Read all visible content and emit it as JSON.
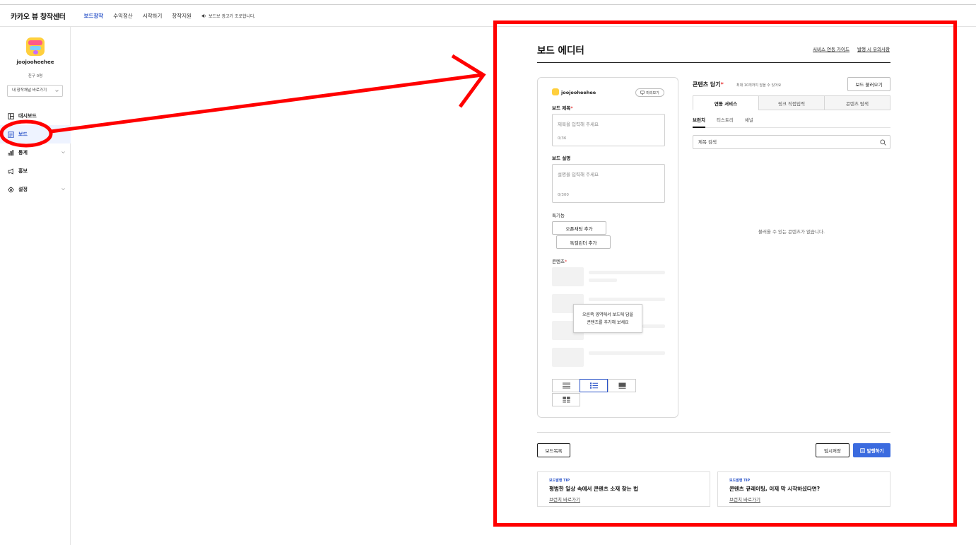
{
  "header": {
    "brand": "카카오 뷰 창작센터",
    "nav": [
      "보드창작",
      "수익정산",
      "시작하기",
      "창작지원"
    ],
    "active_nav": 0,
    "notice": "보드보 광고가 조로합니다."
  },
  "sidebar": {
    "profile_name": "joojooheehee",
    "friends": "친구 0명",
    "channel_select": "내 창작채널 바로가기",
    "items": [
      {
        "label": "대시보드",
        "icon": "dashboard-icon"
      },
      {
        "label": "보드",
        "icon": "board-icon",
        "active": true
      },
      {
        "label": "통계",
        "icon": "stats-icon",
        "expandable": true
      },
      {
        "label": "홍보",
        "icon": "megaphone-icon"
      },
      {
        "label": "설정",
        "icon": "gear-icon",
        "expandable": true
      }
    ]
  },
  "editor": {
    "title": "보드 에디터",
    "links": [
      "서비스 연동 가이드",
      "발행 시 유의사항"
    ],
    "left_card": {
      "profile_name": "joojooheehee",
      "preview_label": "미리보기",
      "board_title_label": "보드 제목",
      "board_title_placeholder": "제목을 입력해 주세요",
      "board_title_count": "0/36",
      "board_desc_label": "보드 설명",
      "board_desc_placeholder": "설명을 입력해 주세요",
      "board_desc_count": "0/300",
      "special_label": "특기능",
      "open_chat_btn": "오픈채팅 추가",
      "talk_calendar_btn": "톡캘린더 추가",
      "content_label": "콘텐츠",
      "content_tip_line1": "오른쪽 영역에서 보드에 담을",
      "content_tip_line2": "콘텐츠를 추가해 보세요"
    },
    "right_panel": {
      "title": "콘텐츠 담기",
      "subtitle": "최대 10개까지 담을 수 있어요",
      "load_btn": "보드 불러오기",
      "tabs": [
        "연동 서비스",
        "링크 직접입력",
        "콘텐츠 탐색"
      ],
      "active_tab": 0,
      "subtabs": [
        "브런치",
        "티스토리",
        "채널"
      ],
      "active_subtab": 0,
      "search_placeholder": "제목 검색",
      "empty_message": "불러올 수 있는 콘텐츠가 없습니다."
    },
    "actions": {
      "list_btn": "보드목록",
      "save_btn": "임시저장",
      "publish_btn": "발행하기"
    },
    "tips": [
      {
        "tag": "보드발행 TIP",
        "title": "평범한 일상 속에서 콘텐츠 소재 찾는 법",
        "link": "브런치 바로가기"
      },
      {
        "tag": "보드발행 TIP",
        "title": "콘텐츠 큐레이팅, 이제 막 시작하셨다면?",
        "link": "브런치 바로가기"
      }
    ]
  },
  "colors": {
    "accent": "#2b54c8",
    "publish": "#3b6bdf",
    "annotation": "#ff0000"
  }
}
